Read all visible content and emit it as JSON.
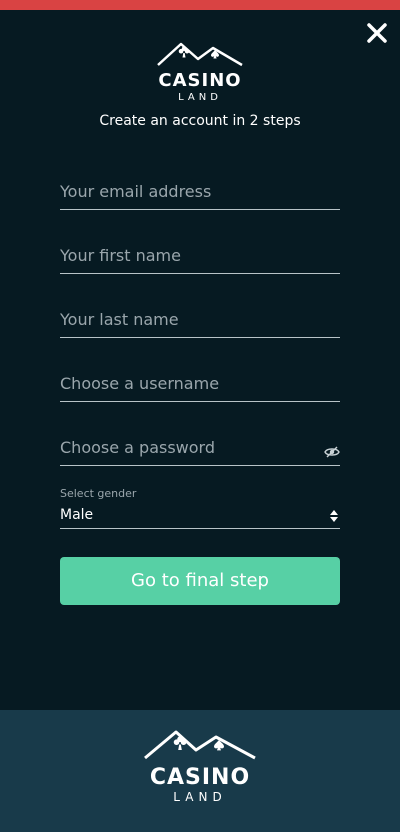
{
  "header": {
    "close_icon": "close-icon",
    "accent_color": "#d94343"
  },
  "logo": {
    "brand_line1": "CASINO",
    "brand_line2": "LAND",
    "icon": "mountains-with-card-suits-icon"
  },
  "subtitle": "Create an account in 2 steps",
  "form": {
    "email": {
      "placeholder": "Your email address",
      "value": ""
    },
    "first_name": {
      "placeholder": "Your first name",
      "value": ""
    },
    "last_name": {
      "placeholder": "Your last name",
      "value": ""
    },
    "username": {
      "placeholder": "Choose a username",
      "value": ""
    },
    "password": {
      "placeholder": "Choose a password",
      "value": "",
      "toggle_icon": "eye-hidden-icon"
    },
    "gender": {
      "label": "Select gender",
      "selected": "Male",
      "icon": "select-arrows-icon"
    },
    "submit_label": "Go to final step",
    "submit_color": "#57d0a5"
  },
  "footer": {
    "logo_line1": "CASINO",
    "logo_line2": "LAND"
  }
}
